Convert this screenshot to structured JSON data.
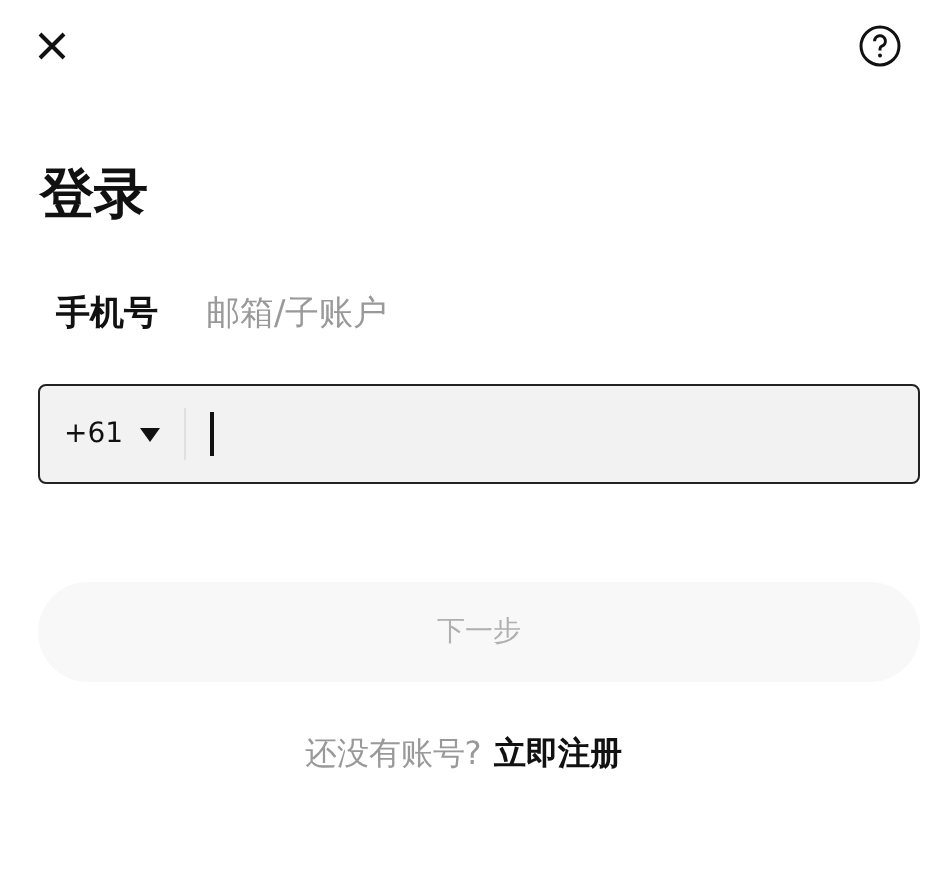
{
  "title": "登录",
  "tabs": [
    {
      "label": "手机号",
      "selected": true
    },
    {
      "label": "邮箱/子账户",
      "selected": false
    }
  ],
  "phone_field": {
    "country_code": "+61",
    "focused": true
  },
  "next_button": {
    "label": "下一步",
    "disabled": true
  },
  "footer": {
    "prompt": "还没有账号?",
    "link": "立即注册"
  }
}
